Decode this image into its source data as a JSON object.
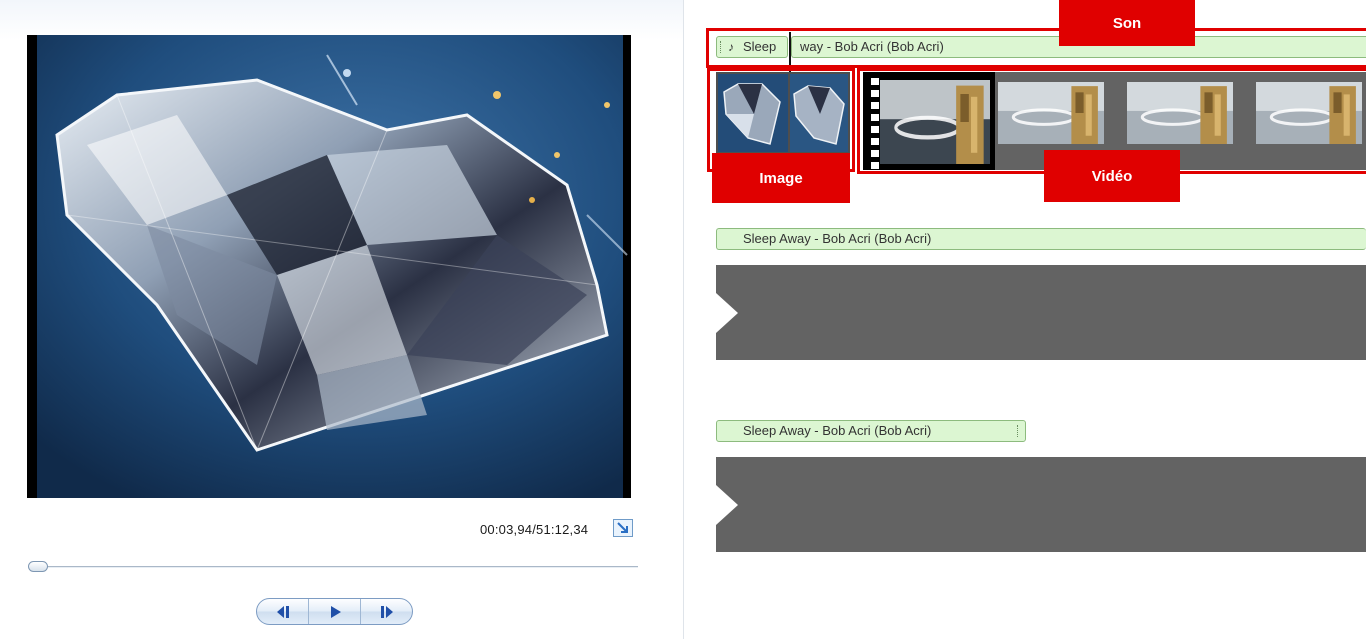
{
  "preview": {
    "time_readout": "00:03,94/51:12,34",
    "seek_progress": 0.0,
    "controls": {
      "previous_frame": "previous-frame",
      "play": "play",
      "next_frame": "next-frame"
    }
  },
  "storyboard": {
    "annotations": {
      "sound": "Son",
      "image": "Image",
      "video": "Vidéo"
    },
    "tracks": [
      {
        "audio_title": "Sleep Away - Bob Acri (Bob Acri)",
        "audio_split_first": "Sleep",
        "audio_split_rest": "way - Bob Acri (Bob Acri)"
      },
      {
        "audio_title": "Sleep Away - Bob Acri (Bob Acri)"
      },
      {
        "audio_title": "Sleep Away - Bob Acri (Bob Acri)"
      }
    ]
  },
  "colors": {
    "annotation_red": "#e00000",
    "audio_green": "#dcf6d2",
    "filmstrip_gray": "#636363",
    "transport_blue": "#1f4fa8"
  }
}
